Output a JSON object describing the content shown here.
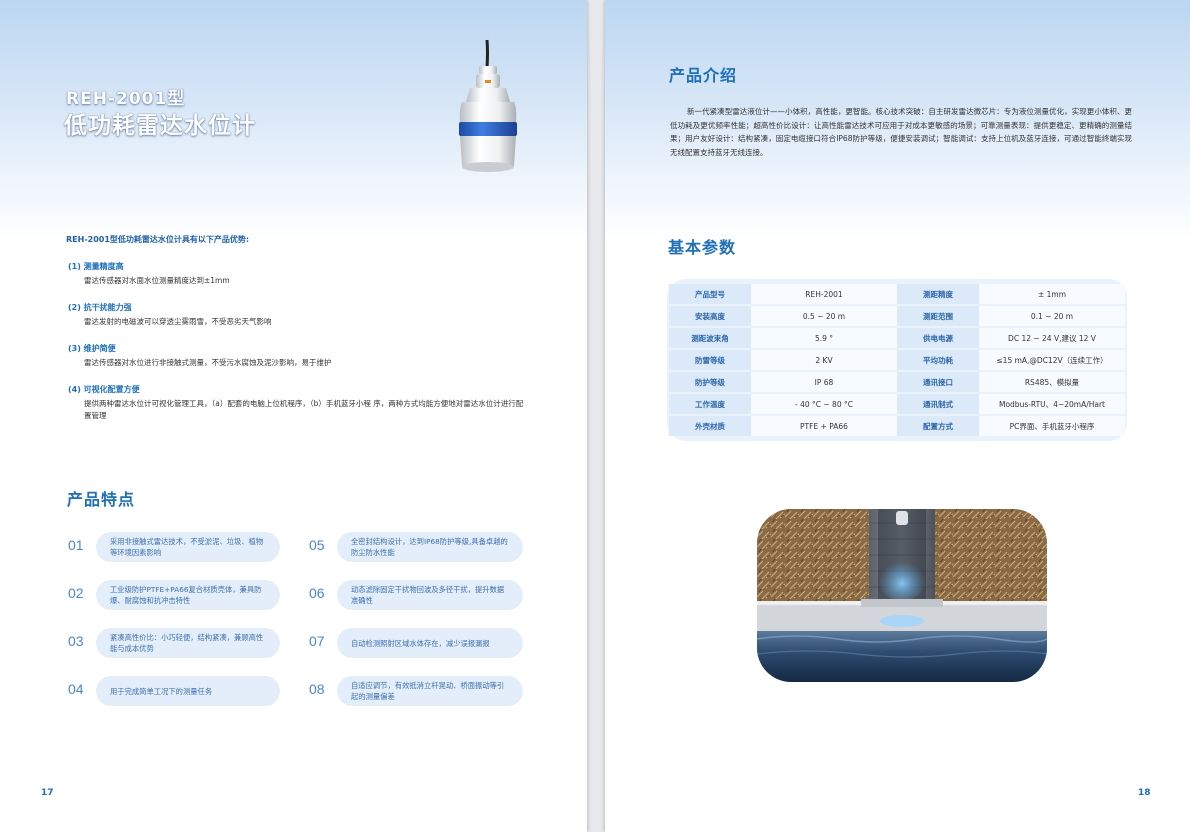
{
  "left_page": {
    "model_title": "REH-2001型",
    "main_title": "低功耗雷达水位计",
    "advantages_heading": "REH-2001型低功耗雷达水位计具有以下产品优势:",
    "advantages": [
      {
        "title": "(1)  测量精度高",
        "desc": "雷达传感器对水面水位测量精度达到±1mm"
      },
      {
        "title": "(2)  抗干扰能力强",
        "desc": "雷达发射的电磁波可以穿透尘雾雨雪，不受恶劣天气影响"
      },
      {
        "title": "(3)  维护简便",
        "desc": "雷达传感器对水位进行非接触式测量，不受污水腐蚀及泥沙影响，易于维护"
      },
      {
        "title": "(4)  可视化配置方便",
        "desc": "提供两种雷达水位计可视化管理工具，（a）配套的电脑上位机程序，（b）手机蓝牙小程 序，两种方式均能方便地对雷达水位计进行配置管理"
      }
    ],
    "features_heading": "产品特点",
    "features": [
      {
        "num": "01",
        "text": "采用非接触式雷达技术，不受淤泥、垃圾、植物等环境因素影响"
      },
      {
        "num": "02",
        "text": "工业级防护PTFE+PA66复合材质壳体，兼具防爆、耐腐蚀和抗冲击特性"
      },
      {
        "num": "03",
        "text": "紧凑高性价比：小巧轻便，结构紧凑，兼顾高性能与成本优势"
      },
      {
        "num": "04",
        "text": "用于完成简单工况下的测量任务"
      },
      {
        "num": "05",
        "text": "全密封结构设计，达到IP68防护等级,具备卓越的防尘防水性能"
      },
      {
        "num": "06",
        "text": "动态滤除固定干扰物回波及多径干扰，提升数据准确性"
      },
      {
        "num": "07",
        "text": "自动检测照射区域水体存在，减少误报漏报"
      },
      {
        "num": "08",
        "text": "自适应调节，有效抵消立杆晃动、桥面振动等引起的测量偏差"
      }
    ],
    "page_number": "17"
  },
  "right_page": {
    "intro_heading": "产品介绍",
    "intro_text": "新一代紧凑型雷达液位计——小体积，高性能，更智能。核心技术突破：自主研发雷达微芯片：专为液位测量优化，实现更小体积、更低功耗及更优频率性能；超高性价比设计：让高性能雷达技术可应用于对成本更敏感的场景；可靠测量表现：提供更稳定、更精确的测量结果；用户友好设计：结构紧凑，固定电缆接口符合IP68防护等级，便捷安装调试；智能调试：支持上位机及蓝牙连接，可通过智能终端实现无线配置支持蓝牙无线连接。",
    "params_heading": "基本参数",
    "params": [
      [
        "产品型号",
        "REH-2001",
        "测距精度",
        "± 1mm"
      ],
      [
        "安装高度",
        "0.5 ~ 20 m",
        "测距范围",
        "0.1 ~ 20 m"
      ],
      [
        "测距波束角",
        "5.9 °",
        "供电电源",
        "DC 12 ~ 24 V,建议 12 V"
      ],
      [
        "防雷等级",
        "2 KV",
        "平均功耗",
        "≤15 mA,@DC12V（连续工作）"
      ],
      [
        "防护等级",
        "IP 68",
        "通讯接口",
        "RS485、模拟量"
      ],
      [
        "工作温度",
        "- 40 °C ~ 80 °C",
        "通讯制式",
        "Modbus-RTU、4~20mA/Hart"
      ],
      [
        "外壳材质",
        "PTFE + PA66",
        "配置方式",
        "PC界面、手机蓝牙小程序"
      ]
    ],
    "page_number": "18"
  },
  "colors": {
    "accent": "#1f6fb8",
    "pill": "#e3eefa",
    "label_cell": "#dbe9f8"
  }
}
